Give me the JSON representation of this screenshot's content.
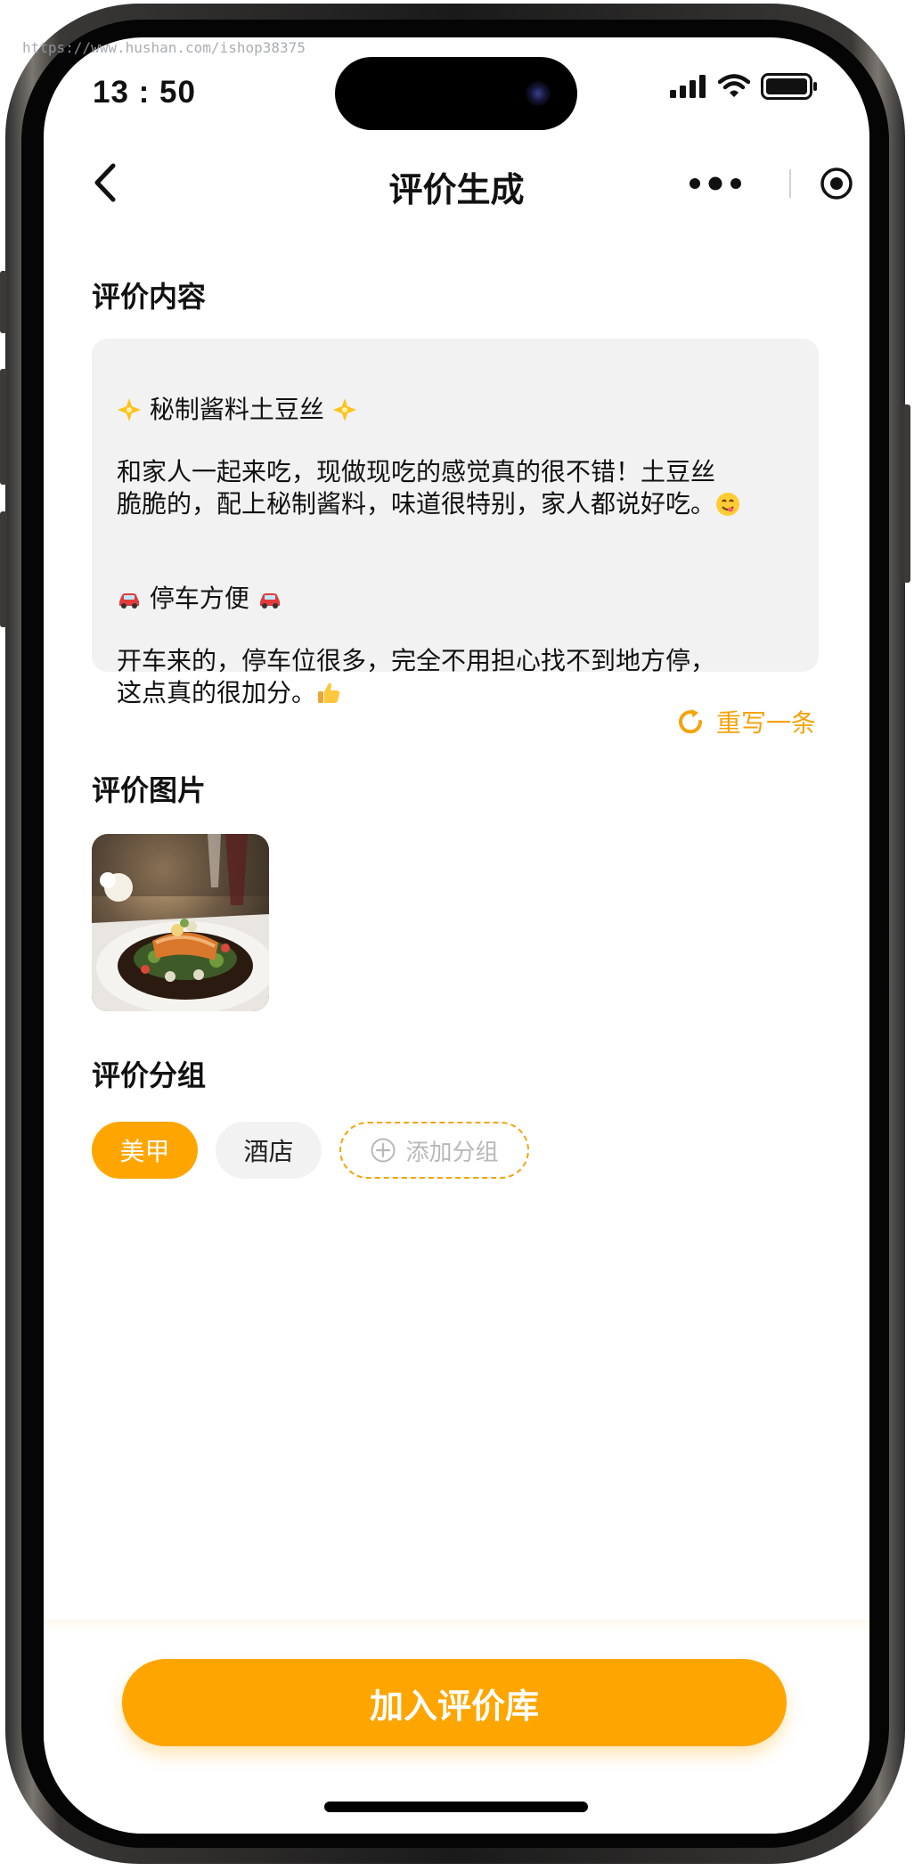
{
  "watermark": "https://www.hushan.com/ishop38375",
  "status_bar": {
    "time": "13 : 50",
    "icons": [
      "cellular-signal-icon",
      "wifi-icon",
      "battery-icon"
    ]
  },
  "nav": {
    "back_icon": "chevron-left-icon",
    "title": "评价生成",
    "menu_icon": "more-dots-icon",
    "close_icon": "record-circle-icon"
  },
  "review_content": {
    "section_title": "评价内容",
    "blocks": [
      {
        "emoji_left": "sparkle-star-icon",
        "heading": " 秘制酱料土豆丝 ",
        "emoji_right": "sparkle-star-icon"
      },
      {
        "text": "和家人一起来吃，现做现吃的感觉真的很不错！土豆丝\n脆脆的，配上秘制酱料，味道很特别，家人都说好吃。",
        "emoji": "yum-face-icon"
      },
      {
        "emoji_left": "car-icon",
        "heading": " 停车方便 ",
        "emoji_right": "car-icon"
      },
      {
        "text": "开车来的，停车位很多，完全不用担心找不到地方停，\n这点真的很加分。",
        "emoji": "thumbs-up-icon"
      }
    ],
    "rewrite_icon": "refresh-icon",
    "rewrite_label": "重写一条"
  },
  "review_images": {
    "section_title": "评价图片",
    "photo_subject": "salmon-dish-photo"
  },
  "review_group": {
    "section_title": "评价分组",
    "chips": [
      "美甲",
      "酒店"
    ],
    "add_icon": "plus-circle-icon",
    "add_label": "添加分组"
  },
  "footer": {
    "primary_button": "加入评价库"
  },
  "colors": {
    "accent": "#ffa500",
    "accent_text": "#f5a30c",
    "card_bg": "#f2f2f2",
    "text": "#111111",
    "placeholder": "#b8b8b8"
  }
}
